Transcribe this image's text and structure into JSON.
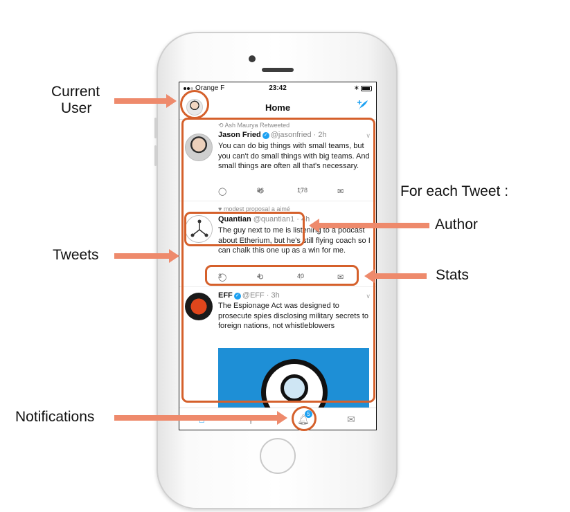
{
  "annotations": {
    "current_user_line1": "Current",
    "current_user_line2": "User",
    "tweets": "Tweets",
    "notifications": "Notifications",
    "for_each_tweet": "For each Tweet :",
    "author": "Author",
    "stats": "Stats",
    "accent_color": "#d5602b",
    "arrow_color": "#ee8a6c"
  },
  "status_bar": {
    "carrier": "Orange F",
    "time": "23:42"
  },
  "nav": {
    "title": "Home",
    "left_icon": "user-avatar",
    "right_icon": "compose-tweet-icon"
  },
  "tweets": [
    {
      "context": "Ash Maurya Retweeted",
      "name": "Jason Fried",
      "verified": true,
      "handle_time": "@jasonfried · 2h",
      "text": "You can do big things with small teams, but you can't do small things with big teams. And small things are often all that's necessary.",
      "replies": "",
      "retweets": "86",
      "likes": "178"
    },
    {
      "context": "modest proposal a aimé",
      "name": "Quantian",
      "verified": false,
      "handle_time": "@quantian1 · 4h",
      "text": "The guy next to me is listening to a podcast about Etherium, but he's still flying coach so I can chalk this one up as a win for me.",
      "replies": "3",
      "retweets": "4",
      "likes": "40"
    },
    {
      "context": "",
      "name": "EFF",
      "verified": true,
      "handle_time": "@EFF · 3h",
      "text": "The Espionage Act was designed to prosecute spies disclosing military secrets to foreign nations, not whistleblowers",
      "replies": "",
      "retweets": "",
      "likes": ""
    }
  ],
  "tabbar": {
    "notification_badge": "5"
  },
  "colors": {
    "twitter_blue": "#1da1f2"
  }
}
